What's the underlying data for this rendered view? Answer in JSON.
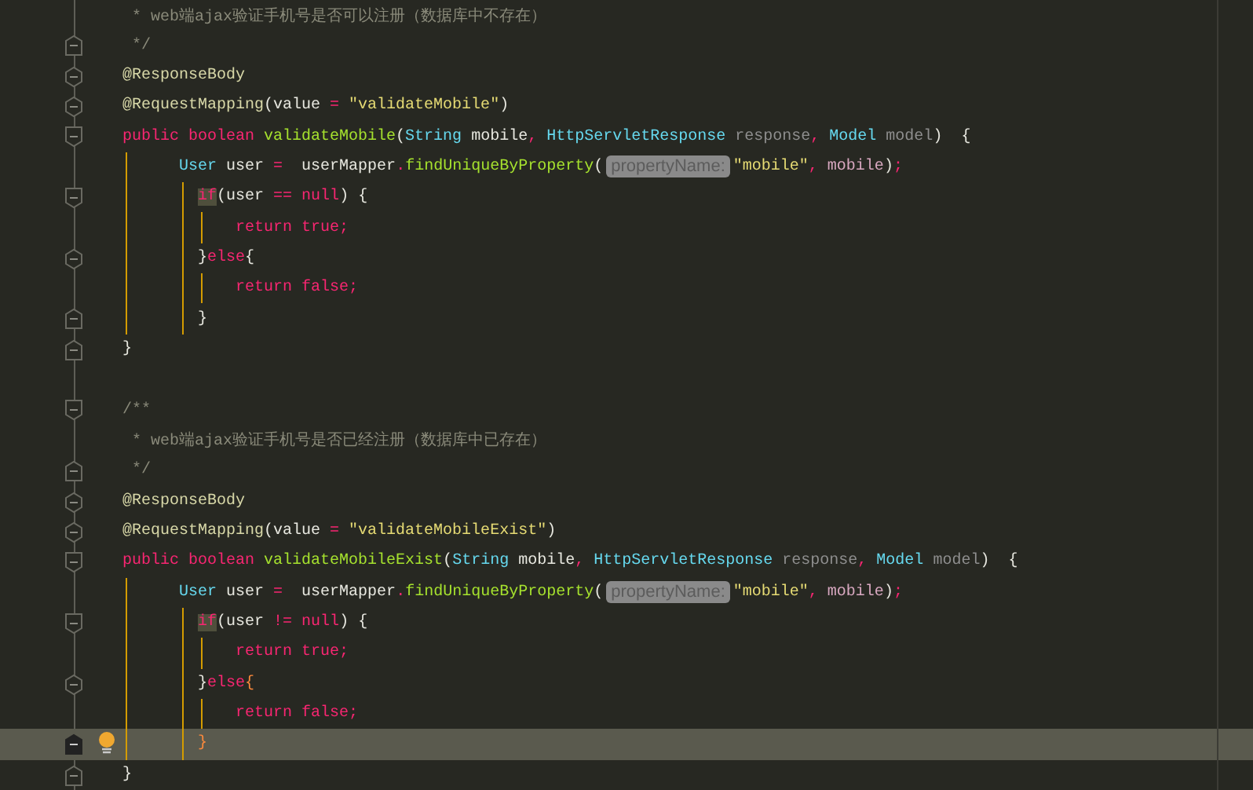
{
  "lines": [
    {
      "kind": "doc",
      "current": false,
      "tokens": [
        {
          "kind": "comment",
          "text": "* web端ajax验证手机号是否可以注册（数据库中不存在）"
        }
      ]
    },
    {
      "kind": "doc",
      "fold": {
        "kind": "end"
      },
      "current": false,
      "tokens": [
        {
          "kind": "comment",
          "text": "*/"
        }
      ]
    },
    {
      "kind": "top",
      "fold": {
        "kind": "both"
      },
      "current": false,
      "tokens": [
        {
          "kind": "annotation",
          "text": "@ResponseBody"
        }
      ]
    },
    {
      "kind": "top",
      "fold": {
        "kind": "both"
      },
      "current": false,
      "tokens": [
        {
          "kind": "annotation",
          "text": "@RequestMapping"
        },
        {
          "kind": "plain",
          "text": "(value "
        },
        {
          "kind": "op",
          "text": "="
        },
        {
          "kind": "string",
          "text": " \"validateMobile\""
        },
        {
          "kind": "plain",
          "text": ")"
        }
      ]
    },
    {
      "kind": "top",
      "fold": {
        "kind": "start"
      },
      "current": false,
      "tokens": [
        {
          "kind": "keyword",
          "text": "public boolean "
        },
        {
          "kind": "method",
          "text": "validateMobile"
        },
        {
          "kind": "plain",
          "text": "("
        },
        {
          "kind": "type",
          "text": "String"
        },
        {
          "kind": "plain",
          "text": " mobile"
        },
        {
          "kind": "op",
          "text": ", "
        },
        {
          "kind": "type",
          "text": "HttpServletResponse"
        },
        {
          "kind": "param",
          "text": " response"
        },
        {
          "kind": "op",
          "text": ", "
        },
        {
          "kind": "type",
          "text": "Model"
        },
        {
          "kind": "param",
          "text": " model"
        },
        {
          "kind": "plain",
          "text": ")  {"
        }
      ]
    },
    {
      "kind": "body",
      "current": false,
      "tokens": [
        {
          "kind": "type",
          "text": "User"
        },
        {
          "kind": "plain",
          "text": " user "
        },
        {
          "kind": "op",
          "text": "="
        },
        {
          "kind": "plain",
          "text": "  userMapper"
        },
        {
          "kind": "op",
          "text": "."
        },
        {
          "kind": "method",
          "text": "findUniqueByProperty"
        },
        {
          "kind": "plain",
          "text": "("
        },
        {
          "kind": "hint",
          "text": "propertyName:"
        },
        {
          "kind": "string",
          "text": "\"mobile\""
        },
        {
          "kind": "op",
          "text": ", "
        },
        {
          "kind": "ref",
          "text": "mobile"
        },
        {
          "kind": "plain",
          "text": ")"
        },
        {
          "kind": "op",
          "text": ";"
        }
      ]
    },
    {
      "kind": "block",
      "fold": {
        "kind": "start"
      },
      "current": false,
      "tokens": [
        {
          "kind": "keyword-match",
          "text": "if"
        },
        {
          "kind": "plain",
          "text": "(user "
        },
        {
          "kind": "op",
          "text": "=="
        },
        {
          "kind": "keyword",
          "text": " null"
        },
        {
          "kind": "plain",
          "text": ") {"
        }
      ]
    },
    {
      "kind": "inner",
      "current": false,
      "tokens": [
        {
          "kind": "keyword",
          "text": "return true;"
        }
      ]
    },
    {
      "kind": "block",
      "fold": {
        "kind": "both"
      },
      "current": false,
      "tokens": [
        {
          "kind": "plain",
          "text": "}"
        },
        {
          "kind": "keyword",
          "text": "else"
        },
        {
          "kind": "plain",
          "text": "{"
        }
      ]
    },
    {
      "kind": "inner",
      "current": false,
      "tokens": [
        {
          "kind": "keyword",
          "text": "return false;"
        }
      ]
    },
    {
      "kind": "block",
      "fold": {
        "kind": "end"
      },
      "current": false,
      "tokens": [
        {
          "kind": "plain",
          "text": "}"
        }
      ]
    },
    {
      "kind": "top",
      "fold": {
        "kind": "end"
      },
      "current": false,
      "tokens": [
        {
          "kind": "plain",
          "text": "}"
        }
      ]
    },
    {
      "current": false
    },
    {
      "kind": "top",
      "fold": {
        "kind": "start"
      },
      "current": false,
      "tokens": [
        {
          "kind": "comment",
          "text": "/**"
        }
      ]
    },
    {
      "kind": "doc",
      "current": false,
      "tokens": [
        {
          "kind": "comment",
          "text": "* web端ajax验证手机号是否已经注册（数据库中已存在）"
        }
      ]
    },
    {
      "kind": "doc",
      "fold": {
        "kind": "end"
      },
      "current": false,
      "tokens": [
        {
          "kind": "comment",
          "text": "*/"
        }
      ]
    },
    {
      "kind": "top",
      "fold": {
        "kind": "both"
      },
      "current": false,
      "tokens": [
        {
          "kind": "annotation",
          "text": "@ResponseBody"
        }
      ]
    },
    {
      "kind": "top",
      "fold": {
        "kind": "both"
      },
      "current": false,
      "tokens": [
        {
          "kind": "annotation",
          "text": "@RequestMapping"
        },
        {
          "kind": "plain",
          "text": "(value "
        },
        {
          "kind": "op",
          "text": "="
        },
        {
          "kind": "string",
          "text": " \"validateMobileExist\""
        },
        {
          "kind": "plain",
          "text": ")"
        }
      ]
    },
    {
      "kind": "top",
      "fold": {
        "kind": "start"
      },
      "current": false,
      "tokens": [
        {
          "kind": "keyword",
          "text": "public boolean "
        },
        {
          "kind": "method",
          "text": "validateMobileExist"
        },
        {
          "kind": "plain",
          "text": "("
        },
        {
          "kind": "type",
          "text": "String"
        },
        {
          "kind": "plain",
          "text": " mobile"
        },
        {
          "kind": "op",
          "text": ", "
        },
        {
          "kind": "type",
          "text": "HttpServletResponse"
        },
        {
          "kind": "param",
          "text": " response"
        },
        {
          "kind": "op",
          "text": ", "
        },
        {
          "kind": "type",
          "text": "Model"
        },
        {
          "kind": "param",
          "text": " model"
        },
        {
          "kind": "plain",
          "text": ")  {"
        }
      ]
    },
    {
      "kind": "body",
      "current": false,
      "tokens": [
        {
          "kind": "type",
          "text": "User"
        },
        {
          "kind": "plain",
          "text": " user "
        },
        {
          "kind": "op",
          "text": "="
        },
        {
          "kind": "plain",
          "text": "  userMapper"
        },
        {
          "kind": "op",
          "text": "."
        },
        {
          "kind": "method",
          "text": "findUniqueByProperty"
        },
        {
          "kind": "plain",
          "text": "("
        },
        {
          "kind": "hint",
          "text": "propertyName:"
        },
        {
          "kind": "string",
          "text": "\"mobile\""
        },
        {
          "kind": "op",
          "text": ", "
        },
        {
          "kind": "ref",
          "text": "mobile"
        },
        {
          "kind": "plain",
          "text": ")"
        },
        {
          "kind": "op",
          "text": ";"
        }
      ]
    },
    {
      "kind": "block",
      "fold": {
        "kind": "start"
      },
      "current": false,
      "tokens": [
        {
          "kind": "keyword-match",
          "text": "if"
        },
        {
          "kind": "plain",
          "text": "(user "
        },
        {
          "kind": "op",
          "text": "!="
        },
        {
          "kind": "keyword",
          "text": " null"
        },
        {
          "kind": "plain",
          "text": ") {"
        }
      ]
    },
    {
      "kind": "inner",
      "current": false,
      "tokens": [
        {
          "kind": "keyword",
          "text": "return true;"
        }
      ]
    },
    {
      "kind": "block",
      "fold": {
        "kind": "both"
      },
      "current": false,
      "tokens": [
        {
          "kind": "plain",
          "text": "}"
        },
        {
          "kind": "keyword",
          "text": "else"
        },
        {
          "kind": "brace-match",
          "text": "{"
        }
      ]
    },
    {
      "kind": "inner",
      "current": false,
      "tokens": [
        {
          "kind": "keyword",
          "text": "return false;"
        }
      ]
    },
    {
      "kind": "block",
      "fold": {
        "kind": "end"
      },
      "current": true,
      "tokens": [
        {
          "kind": "brace-match",
          "text": "}"
        }
      ]
    },
    {
      "kind": "top",
      "fold": {
        "kind": "end"
      },
      "current": false,
      "tokens": [
        {
          "kind": "plain",
          "text": "}"
        }
      ]
    }
  ]
}
